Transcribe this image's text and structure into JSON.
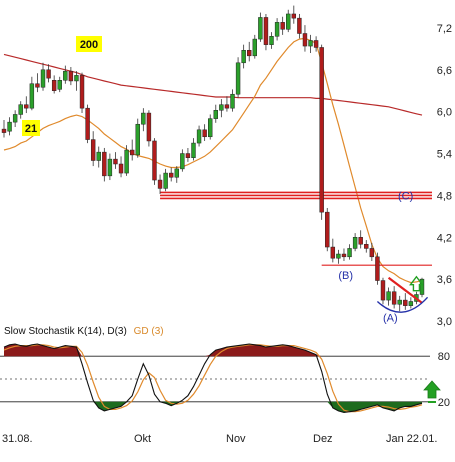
{
  "chart_data": [
    {
      "type": "candlestick",
      "y_ticks": [
        "7,2",
        "6,6",
        "6,0",
        "5,4",
        "4,8",
        "4,2",
        "3,6",
        "3,0"
      ],
      "ylim": [
        2.9,
        7.6
      ],
      "ma_labels": {
        "ma21": "21",
        "ma200": "200"
      },
      "colors": {
        "up": "#2ba02b",
        "down": "#b01c1c",
        "ma21": "#e08a2c",
        "ma200": "#b82a2a",
        "support": "#e02020",
        "wave": "#2430a8",
        "arrow": "#23a023",
        "badge": "#ffff00"
      },
      "candles": [
        {
          "o": 5.75,
          "h": 5.88,
          "l": 5.63,
          "c": 5.7
        },
        {
          "o": 5.72,
          "h": 5.92,
          "l": 5.66,
          "c": 5.85
        },
        {
          "o": 5.85,
          "h": 6.02,
          "l": 5.78,
          "c": 5.96
        },
        {
          "o": 5.96,
          "h": 6.15,
          "l": 5.9,
          "c": 6.1
        },
        {
          "o": 6.1,
          "h": 6.22,
          "l": 5.98,
          "c": 6.05
        },
        {
          "o": 6.05,
          "h": 6.5,
          "l": 6.02,
          "c": 6.4
        },
        {
          "o": 6.4,
          "h": 6.55,
          "l": 6.28,
          "c": 6.35
        },
        {
          "o": 6.35,
          "h": 6.7,
          "l": 6.3,
          "c": 6.6
        },
        {
          "o": 6.6,
          "h": 6.68,
          "l": 6.42,
          "c": 6.48
        },
        {
          "o": 6.45,
          "h": 6.52,
          "l": 6.26,
          "c": 6.3
        },
        {
          "o": 6.32,
          "h": 6.5,
          "l": 6.28,
          "c": 6.45
        },
        {
          "o": 6.45,
          "h": 6.66,
          "l": 6.4,
          "c": 6.58
        },
        {
          "o": 6.58,
          "h": 6.64,
          "l": 6.38,
          "c": 6.44
        },
        {
          "o": 6.44,
          "h": 6.58,
          "l": 6.3,
          "c": 6.52
        },
        {
          "o": 6.52,
          "h": 6.56,
          "l": 5.98,
          "c": 6.05
        },
        {
          "o": 6.05,
          "h": 6.1,
          "l": 5.55,
          "c": 5.6
        },
        {
          "o": 5.6,
          "h": 5.72,
          "l": 5.22,
          "c": 5.3
        },
        {
          "o": 5.3,
          "h": 5.5,
          "l": 5.2,
          "c": 5.42
        },
        {
          "o": 5.42,
          "h": 5.48,
          "l": 5.0,
          "c": 5.08
        },
        {
          "o": 5.08,
          "h": 5.4,
          "l": 5.02,
          "c": 5.32
        },
        {
          "o": 5.32,
          "h": 5.42,
          "l": 5.18,
          "c": 5.25
        },
        {
          "o": 5.25,
          "h": 5.36,
          "l": 5.06,
          "c": 5.12
        },
        {
          "o": 5.12,
          "h": 5.52,
          "l": 5.08,
          "c": 5.45
        },
        {
          "o": 5.45,
          "h": 5.6,
          "l": 5.3,
          "c": 5.38
        },
        {
          "o": 5.38,
          "h": 5.9,
          "l": 5.34,
          "c": 5.82
        },
        {
          "o": 5.82,
          "h": 6.05,
          "l": 5.72,
          "c": 5.98
        },
        {
          "o": 5.98,
          "h": 6.02,
          "l": 5.5,
          "c": 5.58
        },
        {
          "o": 5.58,
          "h": 5.62,
          "l": 4.95,
          "c": 5.02
        },
        {
          "o": 5.02,
          "h": 5.1,
          "l": 4.82,
          "c": 4.9
        },
        {
          "o": 4.9,
          "h": 5.18,
          "l": 4.86,
          "c": 5.12
        },
        {
          "o": 5.12,
          "h": 5.2,
          "l": 5.0,
          "c": 5.06
        },
        {
          "o": 5.06,
          "h": 5.22,
          "l": 4.98,
          "c": 5.18
        },
        {
          "o": 5.18,
          "h": 5.46,
          "l": 5.14,
          "c": 5.4
        },
        {
          "o": 5.4,
          "h": 5.48,
          "l": 5.28,
          "c": 5.34
        },
        {
          "o": 5.34,
          "h": 5.62,
          "l": 5.3,
          "c": 5.55
        },
        {
          "o": 5.55,
          "h": 5.8,
          "l": 5.5,
          "c": 5.74
        },
        {
          "o": 5.74,
          "h": 5.82,
          "l": 5.58,
          "c": 5.64
        },
        {
          "o": 5.64,
          "h": 5.96,
          "l": 5.6,
          "c": 5.9
        },
        {
          "o": 5.9,
          "h": 6.1,
          "l": 5.84,
          "c": 6.02
        },
        {
          "o": 6.02,
          "h": 6.18,
          "l": 5.92,
          "c": 6.1
        },
        {
          "o": 6.1,
          "h": 6.22,
          "l": 6.0,
          "c": 6.05
        },
        {
          "o": 6.05,
          "h": 6.32,
          "l": 6.0,
          "c": 6.25
        },
        {
          "o": 6.25,
          "h": 6.78,
          "l": 6.2,
          "c": 6.7
        },
        {
          "o": 6.7,
          "h": 6.96,
          "l": 6.62,
          "c": 6.88
        },
        {
          "o": 6.88,
          "h": 7.0,
          "l": 6.72,
          "c": 6.8
        },
        {
          "o": 6.8,
          "h": 7.1,
          "l": 6.76,
          "c": 7.04
        },
        {
          "o": 7.04,
          "h": 7.42,
          "l": 7.0,
          "c": 7.35
        },
        {
          "o": 7.35,
          "h": 7.4,
          "l": 6.88,
          "c": 6.96
        },
        {
          "o": 6.96,
          "h": 7.14,
          "l": 6.9,
          "c": 7.08
        },
        {
          "o": 7.08,
          "h": 7.34,
          "l": 7.02,
          "c": 7.28
        },
        {
          "o": 7.28,
          "h": 7.36,
          "l": 7.1,
          "c": 7.18
        },
        {
          "o": 7.18,
          "h": 7.46,
          "l": 7.14,
          "c": 7.4
        },
        {
          "o": 7.4,
          "h": 7.52,
          "l": 7.26,
          "c": 7.34
        },
        {
          "o": 7.34,
          "h": 7.4,
          "l": 7.05,
          "c": 7.12
        },
        {
          "o": 7.12,
          "h": 7.24,
          "l": 6.86,
          "c": 6.94
        },
        {
          "o": 6.94,
          "h": 7.1,
          "l": 6.84,
          "c": 7.02
        },
        {
          "o": 7.02,
          "h": 7.08,
          "l": 6.86,
          "c": 6.92
        },
        {
          "o": 6.92,
          "h": 6.96,
          "l": 4.45,
          "c": 4.56
        },
        {
          "o": 4.56,
          "h": 4.62,
          "l": 4.0,
          "c": 4.06
        },
        {
          "o": 4.06,
          "h": 4.18,
          "l": 3.84,
          "c": 3.9
        },
        {
          "o": 3.9,
          "h": 4.02,
          "l": 3.82,
          "c": 3.96
        },
        {
          "o": 3.96,
          "h": 4.04,
          "l": 3.86,
          "c": 3.92
        },
        {
          "o": 3.92,
          "h": 4.1,
          "l": 3.88,
          "c": 4.04
        },
        {
          "o": 4.04,
          "h": 4.26,
          "l": 4.0,
          "c": 4.2
        },
        {
          "o": 4.2,
          "h": 4.3,
          "l": 4.04,
          "c": 4.1
        },
        {
          "o": 4.1,
          "h": 4.16,
          "l": 3.98,
          "c": 4.04
        },
        {
          "o": 4.04,
          "h": 4.12,
          "l": 3.86,
          "c": 3.92
        },
        {
          "o": 3.92,
          "h": 3.98,
          "l": 3.52,
          "c": 3.58
        },
        {
          "o": 3.58,
          "h": 3.62,
          "l": 3.24,
          "c": 3.3
        },
        {
          "o": 3.3,
          "h": 3.48,
          "l": 3.22,
          "c": 3.42
        },
        {
          "o": 3.42,
          "h": 3.5,
          "l": 3.18,
          "c": 3.24
        },
        {
          "o": 3.24,
          "h": 3.36,
          "l": 3.14,
          "c": 3.3
        },
        {
          "o": 3.3,
          "h": 3.4,
          "l": 3.16,
          "c": 3.22
        },
        {
          "o": 3.22,
          "h": 3.34,
          "l": 3.18,
          "c": 3.28
        },
        {
          "o": 3.28,
          "h": 3.42,
          "l": 3.24,
          "c": 3.38
        },
        {
          "o": 3.38,
          "h": 3.62,
          "l": 3.34,
          "c": 3.6
        }
      ],
      "ma21": [
        5.45,
        5.47,
        5.5,
        5.55,
        5.58,
        5.64,
        5.7,
        5.76,
        5.8,
        5.83,
        5.86,
        5.9,
        5.93,
        5.95,
        5.93,
        5.88,
        5.82,
        5.76,
        5.68,
        5.62,
        5.56,
        5.5,
        5.46,
        5.4,
        5.37,
        5.35,
        5.33,
        5.29,
        5.25,
        5.22,
        5.2,
        5.2,
        5.21,
        5.24,
        5.28,
        5.32,
        5.36,
        5.42,
        5.5,
        5.58,
        5.66,
        5.74,
        5.86,
        5.98,
        6.1,
        6.22,
        6.38,
        6.48,
        6.6,
        6.72,
        6.82,
        6.92,
        7.0,
        7.04,
        7.05,
        7.02,
        6.98,
        6.7,
        6.4,
        6.1,
        5.82,
        5.52,
        5.22,
        4.92,
        4.62,
        4.36,
        4.1,
        3.9,
        3.78,
        3.72,
        3.68,
        3.62,
        3.58,
        3.55,
        3.56,
        3.58
      ],
      "ma200": [
        6.82,
        6.8,
        6.78,
        6.76,
        6.74,
        6.72,
        6.7,
        6.68,
        6.66,
        6.64,
        6.62,
        6.6,
        6.58,
        6.56,
        6.53,
        6.5,
        6.48,
        6.46,
        6.44,
        6.42,
        6.4,
        6.38,
        6.37,
        6.36,
        6.35,
        6.34,
        6.33,
        6.32,
        6.31,
        6.3,
        6.29,
        6.28,
        6.27,
        6.26,
        6.25,
        6.24,
        6.23,
        6.22,
        6.21,
        6.21,
        6.21,
        6.21,
        6.2,
        6.2,
        6.2,
        6.2,
        6.2,
        6.2,
        6.2,
        6.2,
        6.2,
        6.2,
        6.2,
        6.2,
        6.2,
        6.2,
        6.19,
        6.19,
        6.18,
        6.17,
        6.16,
        6.15,
        6.14,
        6.13,
        6.12,
        6.11,
        6.1,
        6.09,
        6.08,
        6.07,
        6.05,
        6.03,
        6.01,
        5.99,
        5.97,
        5.95
      ],
      "support_levels": [
        {
          "label": "(C)",
          "value": 4.8
        },
        {
          "label": "(B)",
          "value": 3.8
        }
      ],
      "wave_labels": [
        "(A)",
        "(B)",
        "(C)"
      ]
    },
    {
      "type": "line",
      "title": "Slow Stochastik K(14), D(3)",
      "title_extra": "GD (3)",
      "y_ticks": [
        "80",
        "20"
      ],
      "ylim": [
        0,
        100
      ],
      "x_tick_labels": [
        "31.08.",
        "Okt",
        "Nov",
        "Dez",
        "Jan 22.01."
      ],
      "overbought": 80,
      "oversold": 20,
      "k": [
        92,
        95,
        96,
        94,
        93,
        95,
        96,
        94,
        92,
        90,
        92,
        94,
        93,
        92,
        70,
        45,
        22,
        12,
        8,
        10,
        12,
        14,
        20,
        28,
        50,
        70,
        55,
        30,
        20,
        18,
        15,
        18,
        22,
        28,
        40,
        55,
        70,
        82,
        88,
        90,
        92,
        93,
        94,
        95,
        96,
        95,
        94,
        92,
        93,
        94,
        95,
        94,
        92,
        90,
        88,
        85,
        82,
        60,
        30,
        12,
        8,
        6,
        7,
        8,
        10,
        12,
        14,
        16,
        12,
        10,
        8,
        12,
        14,
        14,
        16,
        18
      ],
      "d": [
        88,
        91,
        93,
        94,
        94,
        94,
        95,
        95,
        94,
        92,
        91,
        92,
        93,
        93,
        85,
        68,
        46,
        26,
        14,
        10,
        10,
        12,
        15,
        21,
        33,
        49,
        58,
        52,
        35,
        22,
        18,
        17,
        18,
        22,
        30,
        41,
        55,
        69,
        80,
        86,
        90,
        92,
        93,
        94,
        95,
        95,
        95,
        94,
        93,
        93,
        94,
        94,
        94,
        92,
        90,
        88,
        85,
        76,
        57,
        34,
        17,
        9,
        7,
        7,
        8,
        10,
        12,
        14,
        14,
        13,
        11,
        10,
        11,
        13,
        14,
        16
      ],
      "colors": {
        "k": "#111111",
        "d": "#e08a2c",
        "overbought_fill": "#8b1a1a",
        "oversold_fill": "#1e6b1e",
        "arrow": "#23a023"
      }
    }
  ]
}
